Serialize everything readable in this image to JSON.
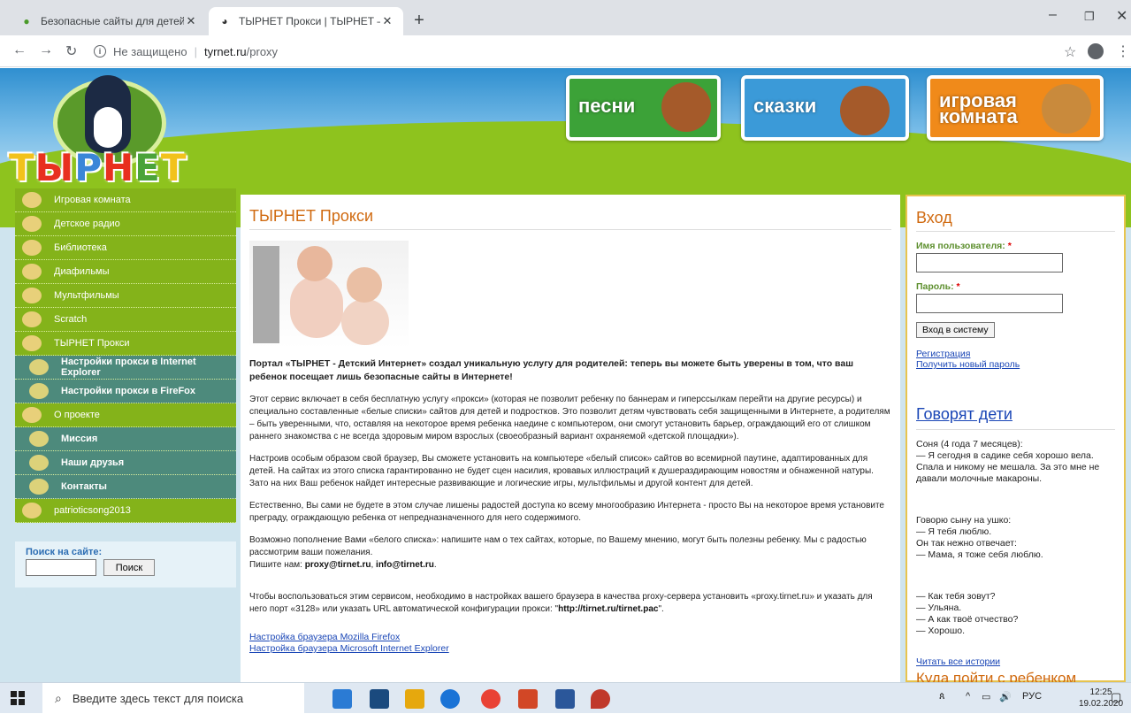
{
  "browser": {
    "tabs": [
      {
        "title": "Безопасные сайты для детей | Г",
        "active": false
      },
      {
        "title": "ТЫРНЕТ Прокси | ТЫРНЕТ — Де",
        "active": true
      }
    ],
    "security_label": "Не защищено",
    "url_domain": "tyrnet.ru",
    "url_path": "/proxy"
  },
  "header": {
    "logo_text": [
      "Т",
      "Ы",
      "Р",
      "Н",
      "Е",
      "Т"
    ],
    "banners": [
      "песни",
      "сказки",
      "игровая комната"
    ]
  },
  "nav": {
    "items": [
      {
        "label": "Игровая комната",
        "sub": false
      },
      {
        "label": "Детское радио",
        "sub": false
      },
      {
        "label": "Библиотека",
        "sub": false
      },
      {
        "label": "Диафильмы",
        "sub": false
      },
      {
        "label": "Мультфильмы",
        "sub": false
      },
      {
        "label": "Scratch",
        "sub": false
      },
      {
        "label": "ТЫРНЕТ Прокси",
        "sub": false
      },
      {
        "label": "Настройки прокси в Internet Explorer",
        "sub": true
      },
      {
        "label": "Настройки прокси в FireFox",
        "sub": true
      },
      {
        "label": "О проекте",
        "sub": false
      },
      {
        "label": "Миссия",
        "sub": true
      },
      {
        "label": "Наши друзья",
        "sub": true
      },
      {
        "label": "Контакты",
        "sub": true
      },
      {
        "label": "patrioticsong2013",
        "sub": false
      }
    ]
  },
  "site_search": {
    "label": "Поиск на сайте:",
    "button": "Поиск"
  },
  "main": {
    "title": "ТЫРНЕТ Прокси",
    "intro_bold": "Портал «ТЫРНЕТ - Детский Интернет» создал уникальную услугу для родителей: теперь вы можете быть уверены в том, что ваш ребенок посещает лишь безопасные сайты в Интернете!",
    "p1": "Этот сервис включает в себя бесплатную услугу «прокси» (которая не позволит ребенку по баннерам и гиперссылкам перейти на другие ресурсы) и  специально составленные «белые списки» сайтов для детей и подростков. Это позволит детям чувствовать себя защищенными в Интернете, а родителям – быть уверенными, что, оставляя на некоторое время ребенка наедине с компьютером, они смогут установить барьер, ограждающий его от слишком раннего знакомства с не всегда здоровым миром взрослых (своеобразный вариант охраняемой «детской площадки»).",
    "p2": "Настроив особым образом свой браузер, Вы сможете установить на компьютере «белый список» сайтов во всемирной паутине, адаптированных для детей. На сайтах из этого списка гарантированно не будет сцен насилия, кровавых иллюстраций к душераздирающим новостям и обнаженной натуры. Зато на них Ваш ребенок найдет интересные развивающие и логические игры, мультфильмы и другой контент для детей.",
    "p3": "Естественно, Вы сами не будете в этом случае лишены радостей доступа ко всему многообразию Интернета - просто Вы на некоторое время установите преграду, ограждающую ребенка от непредназначенного для него содержимого.",
    "p4": "Возможно пополнение Вами «белого списка»: напишите нам о тех сайтах, которые, по Вашему мнению, могут быть полезны ребенку. Мы с радостью рассмотрим ваши пожелания.",
    "write_us_prefix": "Пишите нам: ",
    "email1": "proxy@tirnet.ru",
    "email2": "info@tirnet.ru",
    "p5_pre": "Чтобы воспользоваться этим сервисом, необходимо в настройках вашего браузера в качества proxy-сервера установить «proxy.tirnet.ru» и указать для него порт «3128» или указать URL автоматической конфигурации прокси: \"",
    "p5_url": "http://tirnet.ru/tirnet.pac",
    "p5_post": "\".",
    "link1": "Настройка браузера Mozilla Firefox",
    "link2": "Настройка браузера Microsoft Internet Explorer"
  },
  "login": {
    "title": "Вход",
    "user_label": "Имя пользователя:",
    "pass_label": "Пароль:",
    "required_mark": "*",
    "button": "Вход в систему",
    "register": "Регистрация",
    "new_password": "Получить новый пароль"
  },
  "kids_say": {
    "title": "Говорят дети",
    "story1": "Соня (4 года 7 месяцев):\n— Я сегодня в садике себя хорошо вела. Спала и никому не мешала. За это мне не давали молочные макароны.",
    "story2": "Говорю сыну на ушко:\n— Я тебя люблю.\nОн так нежно отвечает:\n— Мама, я тоже себя люблю.",
    "story3": "— Как тебя зовут?\n— Ульяна.\n— А как твоё отчество?\n— Хорошо.",
    "read_all": "Читать все истории",
    "next_title": "Куда пойти с ребенком"
  },
  "taskbar": {
    "search_placeholder": "Введите здесь текст для поиска",
    "lang": "РУС",
    "time": "12:25",
    "date": "19.02.2020"
  }
}
